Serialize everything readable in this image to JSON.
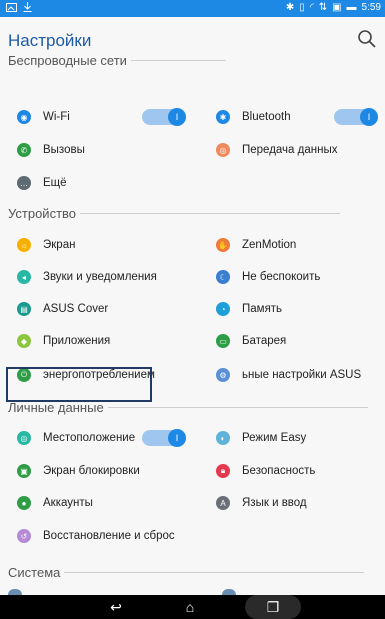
{
  "status": {
    "time": "5:59"
  },
  "header": {
    "title": "Настройки"
  },
  "sections": {
    "wireless": "Беспроводные сети",
    "device": "Устройство",
    "personal": "Личные данные",
    "system": "Система"
  },
  "items": {
    "wifi": "Wi-Fi",
    "bluetooth": "Bluetooth",
    "calls": "Вызовы",
    "data": "Передача данных",
    "more": "Ещё",
    "screen": "Экран",
    "zenmotion": "ZenMotion",
    "sounds": "Звуки и уведомления",
    "dnd": "Не беспокоить",
    "cover": "ASUS Cover",
    "memory": "Память",
    "apps": "Приложения",
    "battery": "Батарея",
    "power": "энергопотреблением",
    "asus": "ьные настройки ASUS",
    "location": "Местоположение",
    "easy": "Режим Easy",
    "lock": "Экран блокировки",
    "security": "Безопасность",
    "accounts": "Аккаунты",
    "language": "Язык и ввод",
    "backup": "Восстановление и сброс"
  },
  "toggles": {
    "on_label": "I"
  },
  "colors": {
    "accent": "#1e88e5",
    "highlight": "#1f3b64"
  }
}
